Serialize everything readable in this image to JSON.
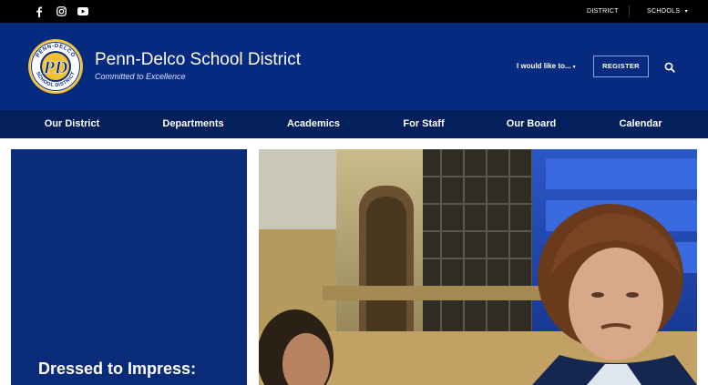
{
  "topbar": {
    "social": [
      {
        "icon": "facebook-icon"
      },
      {
        "icon": "instagram-icon"
      },
      {
        "icon": "youtube-icon"
      }
    ],
    "links": {
      "district": "DISTRICT",
      "schools": "SCHOOLS",
      "schools_caret": "▾"
    }
  },
  "header": {
    "title": "Penn-Delco School District",
    "tagline": "Committed to Excellence",
    "logo_text": {
      "top": "PENN-DELCO",
      "bottom": "SCHOOL DISTRICT",
      "monogram": "PD"
    },
    "i_would_like": "I would like to...",
    "i_would_caret": "▾",
    "register": "REGISTER"
  },
  "nav": {
    "items": [
      {
        "label": "Our District"
      },
      {
        "label": "Departments"
      },
      {
        "label": "Academics"
      },
      {
        "label": "For Staff"
      },
      {
        "label": "Our Board"
      },
      {
        "label": "Calendar"
      }
    ]
  },
  "feature": {
    "title": "Dressed to Impress:"
  },
  "colors": {
    "topbar": "#000000",
    "header": "#062a80",
    "nav": "#03205c",
    "card": "#0a2b79",
    "logo_gold": "#f2c230"
  }
}
